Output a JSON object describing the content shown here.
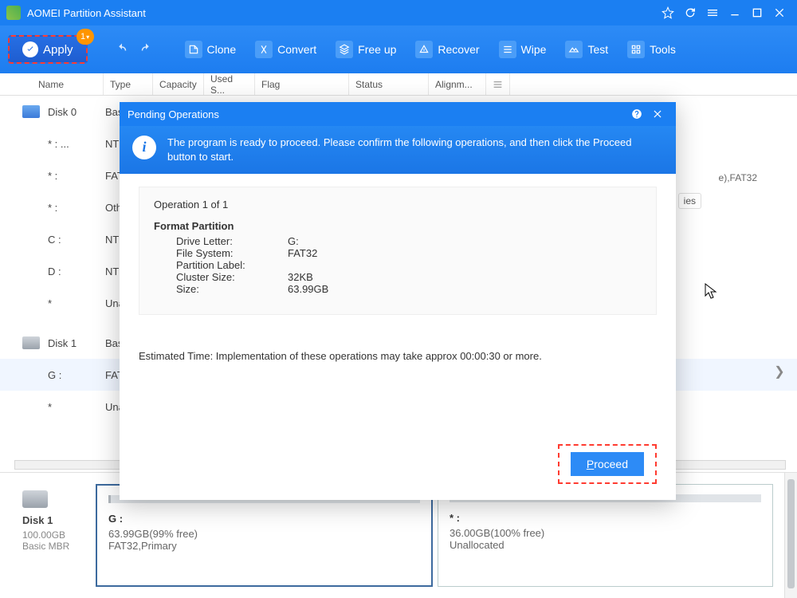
{
  "titlebar": {
    "app_name": "AOMEI Partition Assistant"
  },
  "toolbar": {
    "apply_label": "Apply",
    "apply_badge": "1",
    "items": [
      {
        "label": "Clone"
      },
      {
        "label": "Convert"
      },
      {
        "label": "Free up"
      },
      {
        "label": "Recover"
      },
      {
        "label": "Wipe"
      },
      {
        "label": "Test"
      },
      {
        "label": "Tools"
      }
    ]
  },
  "headers": {
    "name": "Name",
    "type": "Type",
    "cap": "Capacity",
    "used": "Used S...",
    "flag": "Flag",
    "status": "Status",
    "align": "Alignm..."
  },
  "right_text": "e),FAT32",
  "props_label": "ies",
  "disks": [
    {
      "name": "Disk 0",
      "type": "Basi",
      "parts": [
        {
          "name": "* : ...",
          "type": "NTF"
        },
        {
          "name": "* :",
          "type": "FAT"
        },
        {
          "name": "* :",
          "type": "Oth"
        },
        {
          "name": "C :",
          "type": "NTF"
        },
        {
          "name": "D :",
          "type": "NTF"
        },
        {
          "name": "*",
          "type": "Una"
        }
      ]
    },
    {
      "name": "Disk 1",
      "type": "Basi",
      "parts": [
        {
          "name": "G :",
          "type": "FAT",
          "selected": true
        },
        {
          "name": "*",
          "type": "Una"
        }
      ]
    }
  ],
  "bottom": {
    "disk_name": "Disk 1",
    "disk_size": "100.00GB",
    "disk_type": "Basic MBR",
    "parts": [
      {
        "name": "G :",
        "line1": "63.99GB(99% free)",
        "line2": "FAT32,Primary",
        "selected": true
      },
      {
        "name": "* :",
        "line1": "36.00GB(100% free)",
        "line2": "Unallocated",
        "selected": false
      }
    ]
  },
  "modal": {
    "title": "Pending Operations",
    "message": "The program is ready to proceed. Please confirm the following operations,  and then click the Proceed button to start.",
    "op_count": "Operation 1 of 1",
    "op_title": "Format Partition",
    "rows": [
      {
        "lab": "Drive Letter:",
        "val": "G:"
      },
      {
        "lab": "File System:",
        "val": "FAT32"
      },
      {
        "lab": "Partition Label:",
        "val": ""
      },
      {
        "lab": "Cluster Size:",
        "val": "32KB"
      },
      {
        "lab": "Size:",
        "val": "63.99GB"
      }
    ],
    "estimate": "Estimated Time: Implementation of these operations may take approx 00:00:30 or more.",
    "proceed": "Proceed"
  }
}
